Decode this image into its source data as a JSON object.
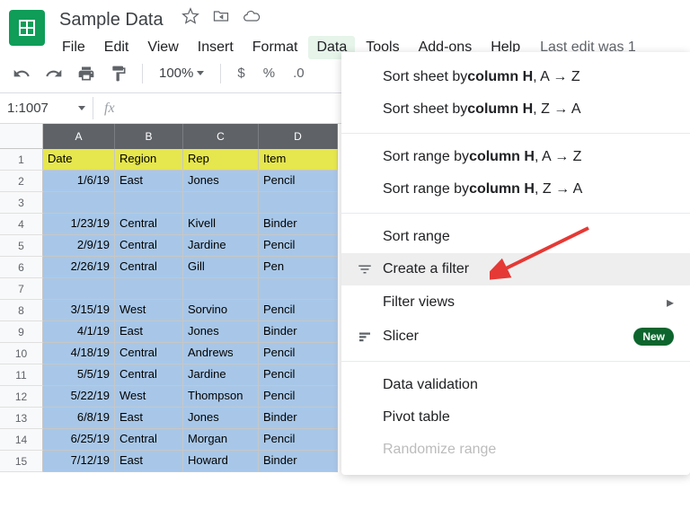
{
  "doc_title": "Sample Data",
  "menu": [
    "File",
    "Edit",
    "View",
    "Insert",
    "Format",
    "Data",
    "Tools",
    "Add-ons",
    "Help"
  ],
  "menu_active_index": 5,
  "last_edit": "Last edit was 1",
  "zoom": "100%",
  "currency": "$",
  "percent": "%",
  "decimal": ".0",
  "name_box": "1:1007",
  "fx": "fx",
  "columns": [
    "A",
    "B",
    "C",
    "D"
  ],
  "rows": [
    {
      "n": 1,
      "header": true,
      "cells": [
        "Date",
        "Region",
        "Rep",
        "Item"
      ]
    },
    {
      "n": 2,
      "cells": [
        "1/6/19",
        "East",
        "Jones",
        "Pencil"
      ]
    },
    {
      "n": 3,
      "blank": true,
      "cells": [
        "",
        "",
        "",
        ""
      ]
    },
    {
      "n": 4,
      "cells": [
        "1/23/19",
        "Central",
        "Kivell",
        "Binder"
      ]
    },
    {
      "n": 5,
      "cells": [
        "2/9/19",
        "Central",
        "Jardine",
        "Pencil"
      ]
    },
    {
      "n": 6,
      "cells": [
        "2/26/19",
        "Central",
        "Gill",
        "Pen"
      ]
    },
    {
      "n": 7,
      "blank": true,
      "cells": [
        "",
        "",
        "",
        ""
      ]
    },
    {
      "n": 8,
      "cells": [
        "3/15/19",
        "West",
        "Sorvino",
        "Pencil"
      ]
    },
    {
      "n": 9,
      "cells": [
        "4/1/19",
        "East",
        "Jones",
        "Binder"
      ]
    },
    {
      "n": 10,
      "cells": [
        "4/18/19",
        "Central",
        "Andrews",
        "Pencil"
      ]
    },
    {
      "n": 11,
      "cells": [
        "5/5/19",
        "Central",
        "Jardine",
        "Pencil"
      ]
    },
    {
      "n": 12,
      "cells": [
        "5/22/19",
        "West",
        "Thompson",
        "Pencil"
      ]
    },
    {
      "n": 13,
      "cells": [
        "6/8/19",
        "East",
        "Jones",
        "Binder"
      ]
    },
    {
      "n": 14,
      "cells": [
        "6/25/19",
        "Central",
        "Morgan",
        "Pencil"
      ]
    },
    {
      "n": 15,
      "cells": [
        "7/12/19",
        "East",
        "Howard",
        "Binder"
      ]
    }
  ],
  "dropdown": {
    "sort_sheet_az": {
      "pre": "Sort sheet by ",
      "bold": "column H",
      "post": ", A → Z"
    },
    "sort_sheet_za": {
      "pre": "Sort sheet by ",
      "bold": "column H",
      "post": ", Z → A"
    },
    "sort_range_az": {
      "pre": "Sort range by ",
      "bold": "column H",
      "post": ", A → Z"
    },
    "sort_range_za": {
      "pre": "Sort range by ",
      "bold": "column H",
      "post": ", Z → A"
    },
    "sort_range": "Sort range",
    "create_filter": "Create a filter",
    "filter_views": "Filter views",
    "slicer": "Slicer",
    "slicer_badge": "New",
    "data_validation": "Data validation",
    "pivot_table": "Pivot table",
    "randomize": "Randomize range"
  }
}
